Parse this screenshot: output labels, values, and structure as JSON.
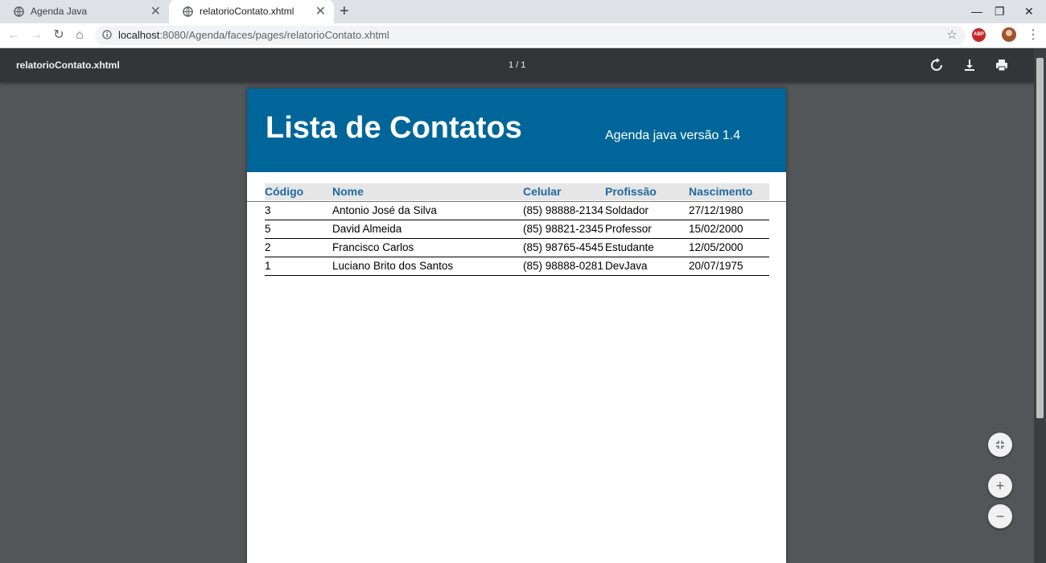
{
  "tabs": [
    {
      "title": "Agenda Java",
      "active": false
    },
    {
      "title": "relatorioContato.xhtml",
      "active": true
    }
  ],
  "address_bar": {
    "host": "localhost",
    "rest": ":8080/Agenda/faces/pages/relatorioContato.xhtml"
  },
  "toolbar_icons": {
    "abp": "ABP"
  },
  "pdf_viewer": {
    "file_title": "relatorioContato.xhtml",
    "page_count": "1 / 1"
  },
  "report": {
    "title": "Lista de Contatos",
    "subtitle": "Agenda java versão 1.4",
    "header_color": "#006699",
    "columns": [
      "Código",
      "Nome",
      "Celular",
      "Profissão",
      "Nascimento"
    ],
    "rows": [
      [
        "3",
        "Antonio José da Silva",
        "(85) 98888-2134",
        "Soldador",
        "27/12/1980"
      ],
      [
        "5",
        "David Almeida",
        "(85) 98821-2345",
        "Professor",
        "15/02/2000"
      ],
      [
        "2",
        "Francisco Carlos",
        "(85) 98765-4545",
        "Estudante",
        "12/05/2000"
      ],
      [
        "1",
        "Luciano Brito dos Santos",
        "(85) 98888-0281",
        "DevJava",
        "20/07/1975"
      ]
    ]
  }
}
